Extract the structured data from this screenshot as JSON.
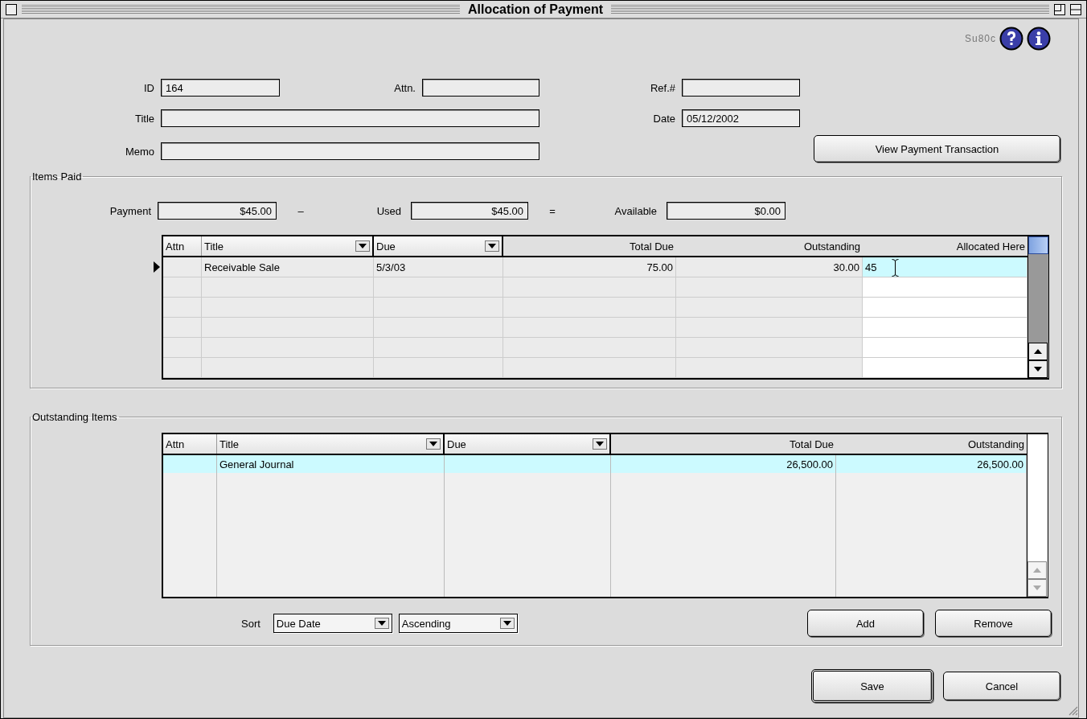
{
  "window": {
    "title": "Allocation of Payment"
  },
  "screen_code": "Su80c",
  "form": {
    "id": {
      "label": "ID",
      "value": "164"
    },
    "attn": {
      "label": "Attn."
    },
    "ref": {
      "label": "Ref.#"
    },
    "title": {
      "label": "Title"
    },
    "date": {
      "label": "Date",
      "value": "05/12/2002"
    },
    "memo": {
      "label": "Memo"
    }
  },
  "view_button": "View Payment Transaction",
  "items_paid": {
    "title": "Items Paid",
    "payment": {
      "label": "Payment",
      "value": "$45.00"
    },
    "minus": "–",
    "used": {
      "label": "Used",
      "value": "$45.00"
    },
    "equals": "=",
    "available": {
      "label": "Available",
      "value": "$0.00"
    },
    "columns": [
      {
        "label": "Attn",
        "dropdown": false
      },
      {
        "label": "Title",
        "dropdown": true
      },
      {
        "label": "Due",
        "dropdown": true
      },
      {
        "label": "Total Due",
        "dropdown": false
      },
      {
        "label": "Outstanding",
        "dropdown": false
      },
      {
        "label": "Allocated Here",
        "dropdown": false
      }
    ],
    "rows": [
      {
        "title": "Receivable Sale",
        "due": "5/3/03",
        "total_due": "75.00",
        "outstanding": "30.00",
        "allocated": "45",
        "selected": true
      }
    ]
  },
  "outstanding_items": {
    "title": "Outstanding Items",
    "columns": [
      {
        "label": "Attn",
        "dropdown": false
      },
      {
        "label": "Title",
        "dropdown": true
      },
      {
        "label": "Due",
        "dropdown": true
      },
      {
        "label": "Total Due",
        "dropdown": false
      },
      {
        "label": "Outstanding",
        "dropdown": false
      }
    ],
    "rows": [
      {
        "title": "General Journal",
        "total_due": "26,500.00",
        "outstanding": "26,500.00",
        "selected": true
      }
    ],
    "sort": {
      "label": "Sort",
      "field": "Due Date",
      "order": "Ascending"
    },
    "buttons": [
      "Add",
      "Remove"
    ]
  },
  "buttons": [
    {
      "label": "Save",
      "default": true
    },
    {
      "label": "Cancel",
      "default": false
    }
  ]
}
